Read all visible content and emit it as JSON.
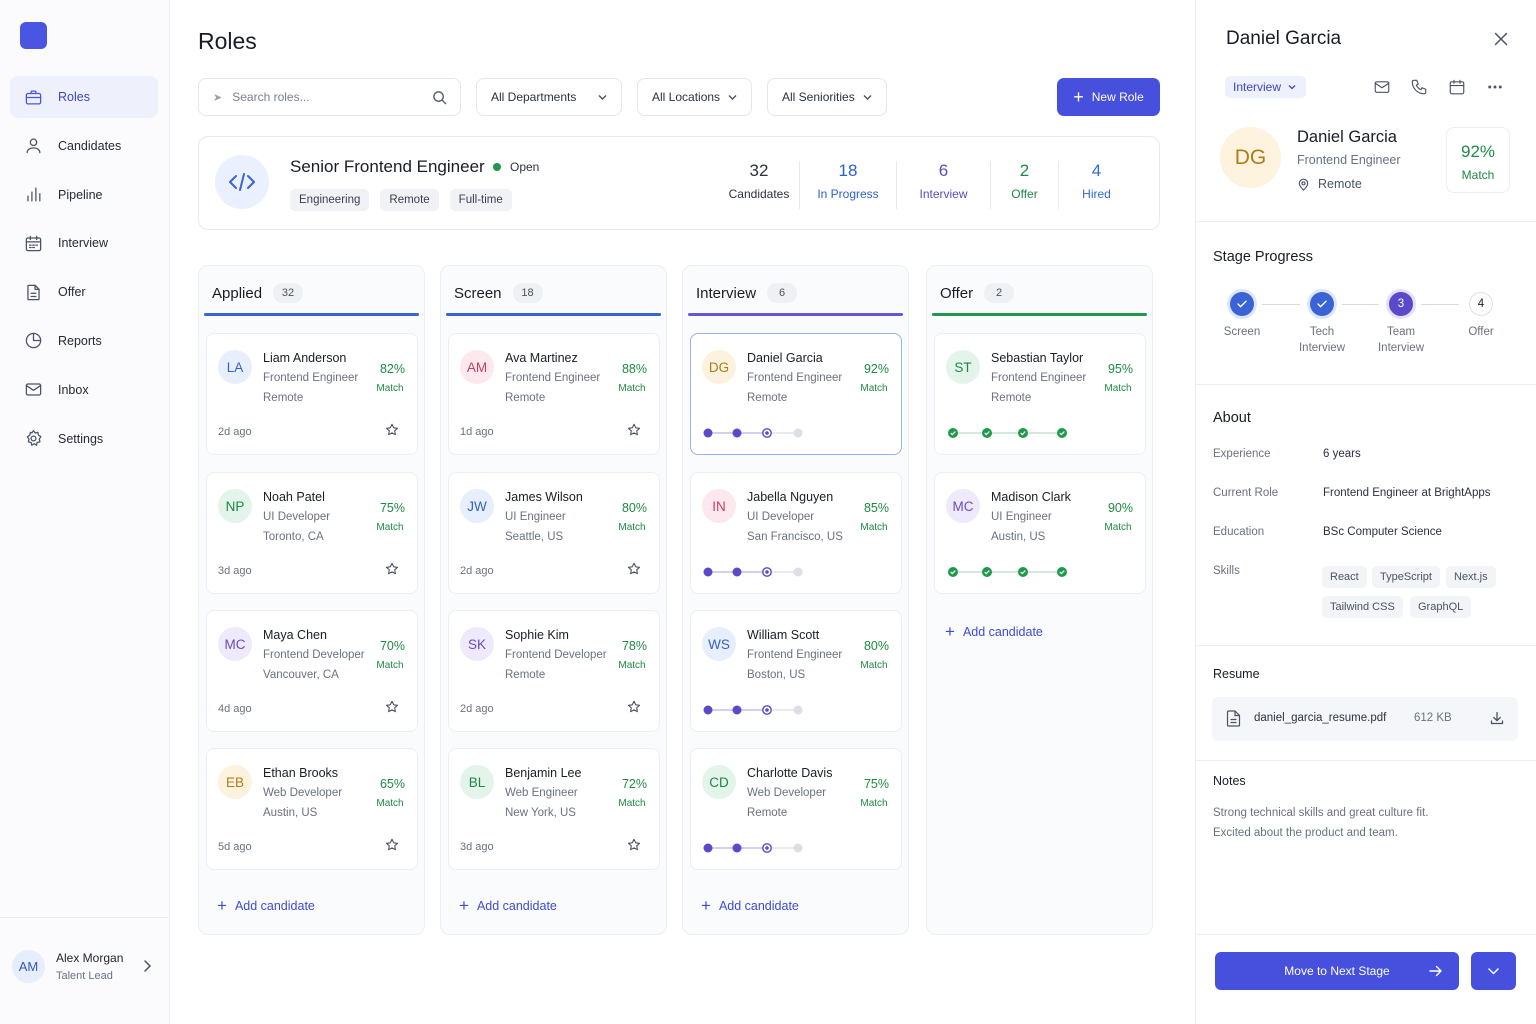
{
  "app": {
    "page_title": "Roles"
  },
  "sidebar": {
    "items": [
      {
        "label": "Roles",
        "icon": "briefcase-icon",
        "active": true
      },
      {
        "label": "Candidates",
        "icon": "user-icon",
        "active": false
      },
      {
        "label": "Pipeline",
        "icon": "bar-chart-icon",
        "active": false
      },
      {
        "label": "Interview",
        "icon": "calendar-icon",
        "active": false
      },
      {
        "label": "Offer",
        "icon": "document-icon",
        "active": false
      },
      {
        "label": "Reports",
        "icon": "pie-chart-icon",
        "active": false
      },
      {
        "label": "Inbox",
        "icon": "mail-icon",
        "active": false
      },
      {
        "label": "Settings",
        "icon": "gear-icon",
        "active": false
      }
    ],
    "user": {
      "initials": "AM",
      "name": "Alex Morgan",
      "role": "Talent Lead"
    }
  },
  "toolbar": {
    "search_placeholder": "Search roles...",
    "departments": "All Departments",
    "locations": "All Locations",
    "seniorities": "All Seniorities",
    "new_role": "New Role"
  },
  "role": {
    "title": "Senior Frontend Engineer",
    "status": "Open",
    "tags": [
      "Engineering",
      "Remote",
      "Full-time"
    ],
    "stats": [
      {
        "value": "32",
        "label": "Candidates",
        "color": "#2c3140"
      },
      {
        "value": "18",
        "label": "In Progress",
        "color": "#2a5fd0"
      },
      {
        "value": "6",
        "label": "Interview",
        "color": "#5a49c9"
      },
      {
        "value": "2",
        "label": "Offer",
        "color": "#1e8a42"
      },
      {
        "value": "4",
        "label": "Hired",
        "color": "#2f6ad8"
      }
    ]
  },
  "board": {
    "add_label": "Add candidate",
    "match_label": "Match",
    "columns": [
      {
        "title": "Applied",
        "count": "32",
        "color": "#3a63d6",
        "cards": [
          {
            "initials": "LA",
            "name": "Liam Anderson",
            "title": "Frontend Engineer",
            "location": "Remote",
            "match": "82%",
            "ago": "2d ago",
            "av_bg": "#e7eefc",
            "av_fg": "#3561c6"
          },
          {
            "initials": "NP",
            "name": "Noah Patel",
            "title": "UI Developer",
            "location": "Toronto, CA",
            "match": "75%",
            "ago": "3d ago",
            "av_bg": "#e3f5ea",
            "av_fg": "#208546"
          },
          {
            "initials": "MC",
            "name": "Maya Chen",
            "title": "Frontend Developer",
            "location": "Vancouver, CA",
            "match": "70%",
            "ago": "4d ago",
            "av_bg": "#efeafb",
            "av_fg": "#6b4bc4"
          },
          {
            "initials": "EB",
            "name": "Ethan Brooks",
            "title": "Web Developer",
            "location": "Austin, US",
            "match": "65%",
            "ago": "5d ago",
            "av_bg": "#fdf2dd",
            "av_fg": "#b07c1a"
          }
        ]
      },
      {
        "title": "Screen",
        "count": "18",
        "color": "#3a63d6",
        "cards": [
          {
            "initials": "AM",
            "name": "Ava Martinez",
            "title": "Frontend Engineer",
            "location": "Remote",
            "match": "88%",
            "ago": "1d ago",
            "av_bg": "#fde8ee",
            "av_fg": "#c73d66"
          },
          {
            "initials": "JW",
            "name": "James Wilson",
            "title": "UI Engineer",
            "location": "Seattle, US",
            "match": "80%",
            "ago": "2d ago",
            "av_bg": "#e7eefc",
            "av_fg": "#3561c6"
          },
          {
            "initials": "SK",
            "name": "Sophie Kim",
            "title": "Frontend Developer",
            "location": "Remote",
            "match": "78%",
            "ago": "2d ago",
            "av_bg": "#efeafb",
            "av_fg": "#6b4bc4"
          },
          {
            "initials": "BL",
            "name": "Benjamin Lee",
            "title": "Web Engineer",
            "location": "New York, US",
            "match": "72%",
            "ago": "3d ago",
            "av_bg": "#e3f5ea",
            "av_fg": "#208546"
          }
        ]
      },
      {
        "title": "Interview",
        "count": "6",
        "color": "#6a55d2",
        "cards": [
          {
            "initials": "DG",
            "name": "Daniel Garcia",
            "title": "Frontend Engineer",
            "location": "Remote",
            "match": "92%",
            "av_bg": "#fdf2dd",
            "av_fg": "#b07c1a",
            "selected": true
          },
          {
            "initials": "IN",
            "name": "Jabella Nguyen",
            "title": "UI Developer",
            "location": "San Francisco, US",
            "match": "85%",
            "av_bg": "#fde8ee",
            "av_fg": "#c73d66"
          },
          {
            "initials": "WS",
            "name": "William Scott",
            "title": "Frontend Engineer",
            "location": "Boston, US",
            "match": "80%",
            "av_bg": "#e7eefc",
            "av_fg": "#3561c6"
          },
          {
            "initials": "CD",
            "name": "Charlotte Davis",
            "title": "Web Developer",
            "location": "Remote",
            "match": "75%",
            "av_bg": "#e3f5ea",
            "av_fg": "#208546"
          }
        ]
      },
      {
        "title": "Offer",
        "count": "2",
        "color": "#23964d",
        "cards": [
          {
            "initials": "ST",
            "name": "Sebastian Taylor",
            "title": "Frontend Engineer",
            "location": "Remote",
            "match": "95%",
            "av_bg": "#e3f5ea",
            "av_fg": "#208546"
          },
          {
            "initials": "MC",
            "name": "Madison Clark",
            "title": "UI Engineer",
            "location": "Austin, US",
            "match": "90%",
            "av_bg": "#efeafb",
            "av_fg": "#6b4bc4"
          }
        ]
      }
    ]
  },
  "panel": {
    "name": "Daniel Garcia",
    "stage": "Interview",
    "initials": "DG",
    "role": "Frontend Engineer",
    "location": "Remote",
    "match": "92%",
    "match_label": "Match",
    "stage_progress_title": "Stage Progress",
    "steps": [
      {
        "label": "Screen",
        "state": "done"
      },
      {
        "label": "Tech Interview",
        "state": "done"
      },
      {
        "label": "Team Interview",
        "state": "current",
        "number": "3"
      },
      {
        "label": "Offer",
        "state": "todo",
        "number": "4"
      }
    ],
    "about_title": "About",
    "about": [
      {
        "key": "Experience",
        "value": "6 years"
      },
      {
        "key": "Current Role",
        "value": "Frontend Engineer at BrightApps"
      },
      {
        "key": "Education",
        "value": "BSc Computer Science"
      }
    ],
    "skills_label": "Skills",
    "skills": [
      "React",
      "TypeScript",
      "Next.js",
      "Tailwind CSS",
      "GraphQL"
    ],
    "resume_title": "Resume",
    "resume_file": "daniel_garcia_resume.pdf",
    "resume_size": "612 KB",
    "notes_title": "Notes",
    "notes_line1": "Strong technical skills and great culture fit.",
    "notes_line2": "Excited about the product and team.",
    "move_button": "Move to Next Stage"
  }
}
